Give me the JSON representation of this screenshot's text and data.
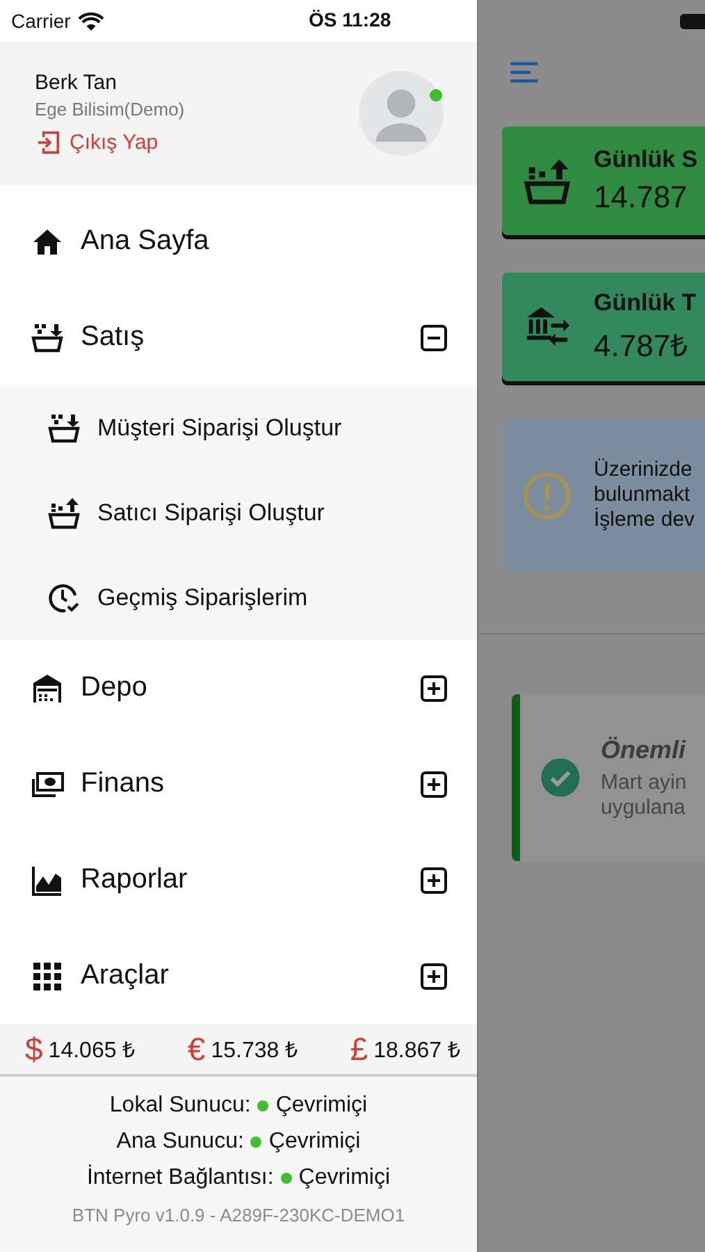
{
  "status_bar": {
    "carrier": "Carrier",
    "time": "ÖS 11:28"
  },
  "drawer": {
    "user": {
      "name": "Berk Tan",
      "company": "Ege Bilisim(Demo)",
      "online": true,
      "logout": "Çıkış Yap"
    },
    "menu": [
      {
        "label": "Ana Sayfa",
        "kind": "link"
      },
      {
        "label": "Satış",
        "kind": "group",
        "expanded": true,
        "children": [
          {
            "label": "Müşteri Siparişi Oluştur"
          },
          {
            "label": "Satıcı Siparişi Oluştur"
          },
          {
            "label": "Geçmiş Siparişlerim"
          }
        ]
      },
      {
        "label": "Depo",
        "kind": "group",
        "expanded": false
      },
      {
        "label": "Finans",
        "kind": "group",
        "expanded": false
      },
      {
        "label": "Raporlar",
        "kind": "group",
        "expanded": false
      },
      {
        "label": "Araçlar",
        "kind": "group",
        "expanded": false
      }
    ],
    "currencies": [
      {
        "symbol": "$",
        "value": "14.065 ₺"
      },
      {
        "symbol": "€",
        "value": "15.738 ₺"
      },
      {
        "symbol": "£",
        "value": "18.867 ₺"
      }
    ],
    "servers": [
      {
        "label": "Lokal Sunucu:",
        "status": "Çevrimiçi",
        "online": true
      },
      {
        "label": "Ana Sunucu:",
        "status": "Çevrimiçi",
        "online": true
      },
      {
        "label": "İnternet Bağlantısı:",
        "status": "Çevrimiçi",
        "online": true
      }
    ],
    "version": "BTN Pyro v1.0.9 - A289F-230KC-DEMO1"
  },
  "background": {
    "cards": [
      {
        "title": "Günlük S",
        "value": "14.787",
        "color": "#2e8b3f"
      },
      {
        "title": "Günlük T",
        "value": "4.787₺",
        "color": "#33895e"
      }
    ],
    "alert": [
      "Üzerinizde",
      "bulunmakt",
      "İşleme dev"
    ],
    "notice": {
      "title": "Önemli",
      "lines": [
        "Mart ayin",
        "uygulana"
      ]
    }
  }
}
